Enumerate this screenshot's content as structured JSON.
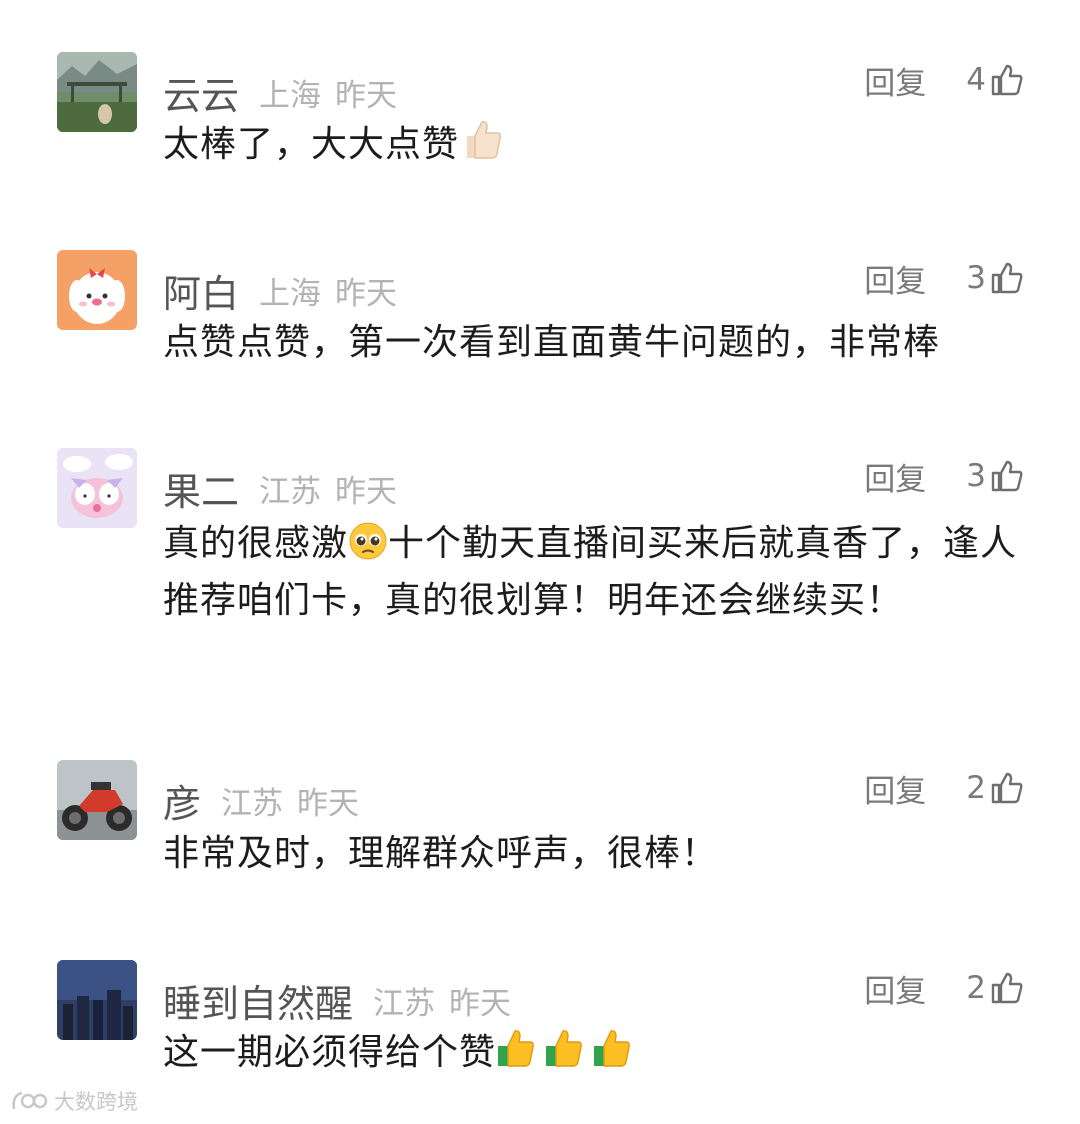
{
  "comments": [
    {
      "name": "云云",
      "location": "上海",
      "time": "昨天",
      "reply_label": "回复",
      "likes": "4",
      "text": "太棒了，大大点赞",
      "text_suffix_emoji": "thumbs-up-light-skin"
    },
    {
      "name": "阿白",
      "location": "上海",
      "time": "昨天",
      "reply_label": "回复",
      "likes": "3",
      "text": "点赞点赞，第一次看到直面黄牛问题的，非常棒"
    },
    {
      "name": "果二",
      "location": "江苏",
      "time": "昨天",
      "reply_label": "回复",
      "likes": "3",
      "text_a": "真的很感激",
      "emoji": "pleading-face",
      "text_b": "十个勤天直播间买来后就真香了，逢人推荐咱们卡，真的很划算！明年还会继续买！"
    },
    {
      "name": "彦",
      "location": "江苏",
      "time": "昨天",
      "reply_label": "回复",
      "likes": "2",
      "text": "非常及时，理解群众呼声，很棒！"
    },
    {
      "name": "睡到自然醒",
      "location": "江苏",
      "time": "昨天",
      "reply_label": "回复",
      "likes": "2",
      "text": "这一期必须得给个赞",
      "text_suffix_emoji": "thumbs-up-x3"
    }
  ],
  "watermark": "大数跨境",
  "colors": {
    "name": "#555555",
    "meta": "#b3b3b3",
    "action": "#7a7a7a",
    "text": "#1c1c1c"
  }
}
